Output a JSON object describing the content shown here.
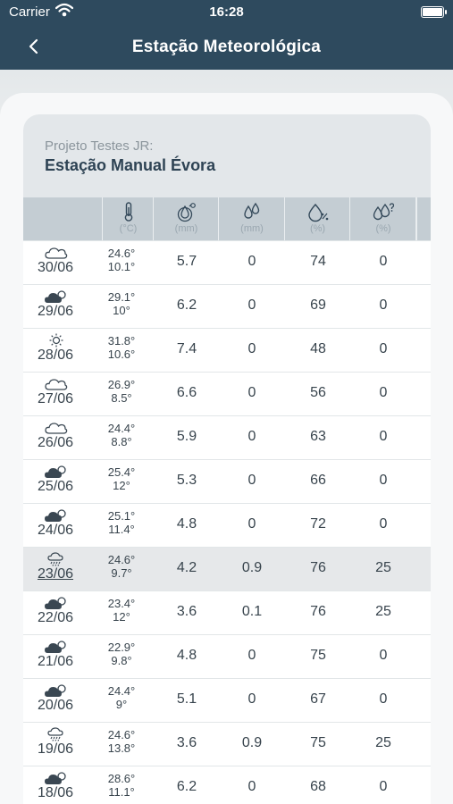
{
  "status_bar": {
    "carrier": "Carrier",
    "time": "16:28"
  },
  "nav": {
    "title": "Estação Meteorológica",
    "back_icon": "chevron-left-icon"
  },
  "station": {
    "project": "Projeto Testes JR:",
    "name": "Estação Manual Évora"
  },
  "table": {
    "columns": [
      {
        "icon": "thermometer-icon",
        "unit": "(°C)"
      },
      {
        "icon": "evaporation-icon",
        "unit": "(mm)"
      },
      {
        "icon": "precipitation-icon",
        "unit": "(mm)"
      },
      {
        "icon": "humidity-icon",
        "unit": "(%)"
      },
      {
        "icon": "rain-probability-icon",
        "unit": "(%)"
      }
    ],
    "rows": [
      {
        "icon": "cloudy-icon",
        "date": "30/06",
        "tmax": "24.6°",
        "tmin": "10.1°",
        "c1": "5.7",
        "c2": "0",
        "c3": "74",
        "c4": "0"
      },
      {
        "icon": "partly-cloudy-icon",
        "date": "29/06",
        "tmax": "29.1°",
        "tmin": "10°",
        "c1": "6.2",
        "c2": "0",
        "c3": "69",
        "c4": "0"
      },
      {
        "icon": "sunny-icon",
        "date": "28/06",
        "tmax": "31.8°",
        "tmin": "10.6°",
        "c1": "7.4",
        "c2": "0",
        "c3": "48",
        "c4": "0"
      },
      {
        "icon": "cloudy-icon",
        "date": "27/06",
        "tmax": "26.9°",
        "tmin": "8.5°",
        "c1": "6.6",
        "c2": "0",
        "c3": "56",
        "c4": "0"
      },
      {
        "icon": "cloudy-icon",
        "date": "26/06",
        "tmax": "24.4°",
        "tmin": "8.8°",
        "c1": "5.9",
        "c2": "0",
        "c3": "63",
        "c4": "0"
      },
      {
        "icon": "partly-cloudy-icon",
        "date": "25/06",
        "tmax": "25.4°",
        "tmin": "12°",
        "c1": "5.3",
        "c2": "0",
        "c3": "66",
        "c4": "0"
      },
      {
        "icon": "partly-cloudy-icon",
        "date": "24/06",
        "tmax": "25.1°",
        "tmin": "11.4°",
        "c1": "4.8",
        "c2": "0",
        "c3": "72",
        "c4": "0"
      },
      {
        "icon": "rain-icon",
        "date": "23/06",
        "tmax": "24.6°",
        "tmin": "9.7°",
        "c1": "4.2",
        "c2": "0.9",
        "c3": "76",
        "c4": "25"
      },
      {
        "icon": "partly-cloudy-icon",
        "date": "22/06",
        "tmax": "23.4°",
        "tmin": "12°",
        "c1": "3.6",
        "c2": "0.1",
        "c3": "76",
        "c4": "25"
      },
      {
        "icon": "partly-cloudy-icon",
        "date": "21/06",
        "tmax": "22.9°",
        "tmin": "9.8°",
        "c1": "4.8",
        "c2": "0",
        "c3": "75",
        "c4": "0"
      },
      {
        "icon": "partly-cloudy-icon",
        "date": "20/06",
        "tmax": "24.4°",
        "tmin": "9°",
        "c1": "5.1",
        "c2": "0",
        "c3": "67",
        "c4": "0"
      },
      {
        "icon": "rain-icon",
        "date": "19/06",
        "tmax": "24.6°",
        "tmin": "13.8°",
        "c1": "3.6",
        "c2": "0.9",
        "c3": "75",
        "c4": "25"
      },
      {
        "icon": "partly-cloudy-icon",
        "date": "18/06",
        "tmax": "28.6°",
        "tmin": "11.1°",
        "c1": "6.2",
        "c2": "0",
        "c3": "68",
        "c4": "0"
      }
    ]
  }
}
